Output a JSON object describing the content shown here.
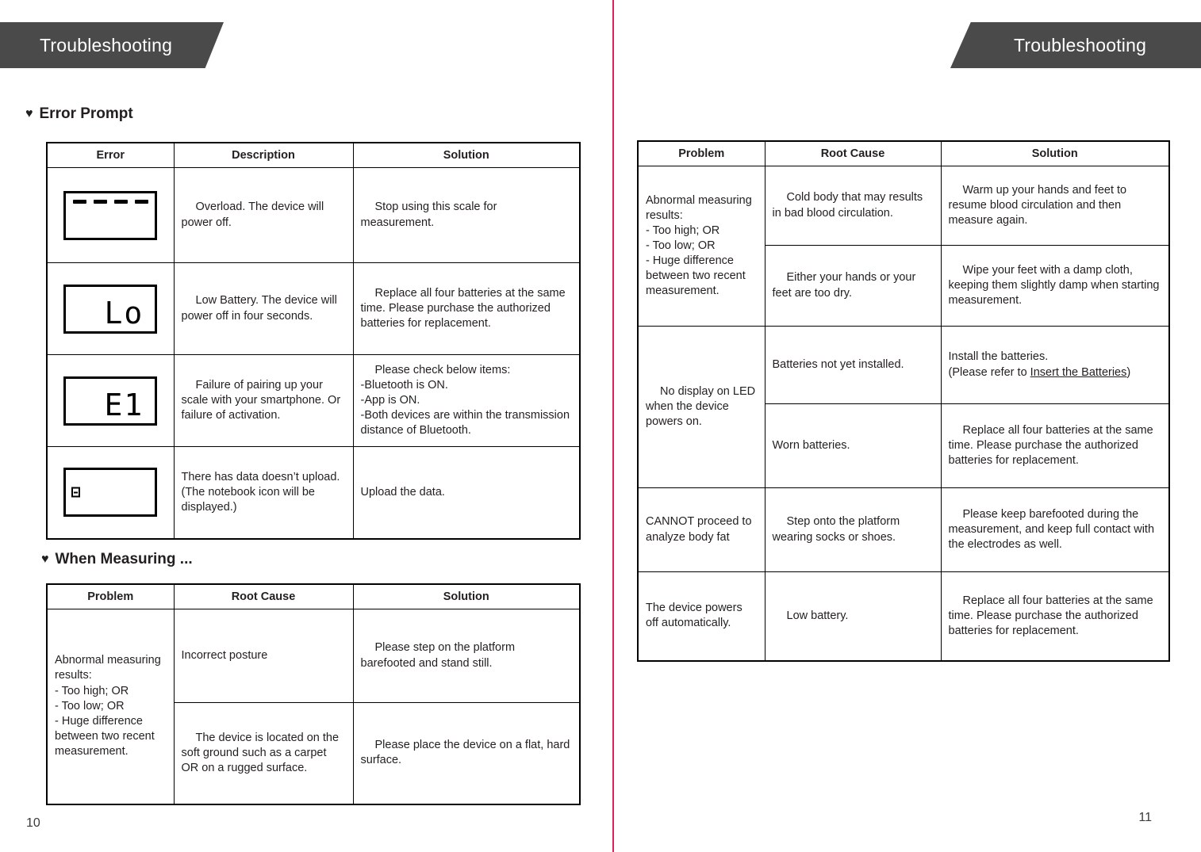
{
  "left_page": {
    "banner_title": "Troubleshooting",
    "page_number": "10",
    "sections": [
      {
        "bullet": "heart-bullet",
        "heading": "Error Prompt",
        "table": {
          "headers": [
            "Error",
            "Description",
            "Solution"
          ],
          "rows": [
            {
              "icon": "lcd-overload-dashes",
              "icon_text": "- - - -",
              "description": "Overload. The device will power off.",
              "solution": "Stop using this scale for measurement."
            },
            {
              "icon": "lcd-low-battery",
              "icon_text": "Lo",
              "description": "Low Battery. The device will power off in four seconds.",
              "solution": "Replace all four batteries at the same time. Please purchase the authorized batteries for replacement."
            },
            {
              "icon": "lcd-error-e1",
              "icon_text": "E1",
              "description": "Failure of pairing up your scale with your smartphone. Or failure of activation.",
              "solution": "Please check below items:\n-Bluetooth is ON.\n-App is ON.\n-Both devices are within the transmission distance of Bluetooth."
            },
            {
              "icon": "lcd-notebook-icon",
              "icon_text": "",
              "description": "There has data doesn’t upload. (The notebook icon will be displayed.)",
              "solution": "Upload the data."
            }
          ]
        }
      },
      {
        "bullet": "heart-bullet",
        "heading": "When Measuring ...",
        "table": {
          "headers": [
            "Problem",
            "Root Cause",
            "Solution"
          ],
          "problem": "Abnormal measuring results:\n   - Too high; OR\n   - Too low; OR\n   - Huge difference between two recent measurement.",
          "rows": [
            {
              "root_cause": "Incorrect posture",
              "solution": "Please step on the platform barefooted and stand still."
            },
            {
              "root_cause": "The device is located on the soft ground such as a carpet OR on a rugged surface.",
              "solution": "Please place the device on a flat, hard surface."
            }
          ]
        }
      }
    ]
  },
  "right_page": {
    "banner_title": "Troubleshooting",
    "page_number": "11",
    "table": {
      "headers": [
        "Problem",
        "Root Cause",
        "Solution"
      ],
      "groups": [
        {
          "problem": "Abnormal measuring results:\n   - Too high; OR\n   - Too low; OR\n   - Huge difference between two recent measurement.",
          "rows": [
            {
              "root_cause": "Cold body that may results in bad blood circulation.",
              "solution": "Warm up your hands and feet to resume blood circulation and then measure again."
            },
            {
              "root_cause": "Either your hands or your feet are too dry.",
              "solution": "Wipe your feet with a damp cloth, keeping them slightly damp when starting measurement."
            }
          ]
        },
        {
          "problem": "No display on LED when the device powers on.",
          "rows": [
            {
              "root_cause": "Batteries not yet installed.",
              "solution_prefix": "Install the batteries.\n(Please refer to ",
              "solution_link": "Insert the Batteries",
              "solution_suffix": ")"
            },
            {
              "root_cause": "Worn batteries.",
              "solution": "Replace all four batteries at the same time. Please purchase the authorized batteries for replacement."
            }
          ]
        },
        {
          "problem": "CANNOT proceed to analyze body fat",
          "rows": [
            {
              "root_cause": "Step onto the platform wearing socks or shoes.",
              "solution": "Please keep barefooted during the measurement, and keep full contact with the electrodes as well."
            }
          ]
        },
        {
          "problem": "The device powers off automatically.",
          "rows": [
            {
              "root_cause": "Low battery.",
              "solution": "Replace all four batteries at the same time. Please purchase the authorized batteries for replacement."
            }
          ]
        }
      ]
    }
  },
  "colors": {
    "banner_background": "#4a4a4a",
    "banner_text": "#ffffff",
    "divider": "#e0205a",
    "body_text": "#231f20",
    "table_border": "#000000"
  }
}
